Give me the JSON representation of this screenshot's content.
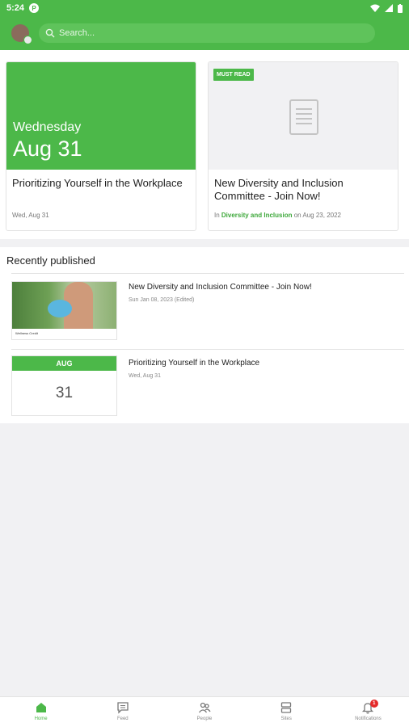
{
  "status_bar": {
    "time": "5:24",
    "app_icon_letter": "P"
  },
  "search": {
    "placeholder": "Search..."
  },
  "featured": [
    {
      "day": "Wednesday",
      "date": "Aug 31",
      "title": "Prioritizing Yourself in the Workplace",
      "meta": "Wed, Aug 31"
    },
    {
      "tag": "MUST READ",
      "title": "New Diversity and Inclusion Committee - Join Now!",
      "meta_prefix": "In",
      "meta_link": "Diversity and Inclusion",
      "meta_suffix": "on Aug 23, 2022"
    }
  ],
  "recent": {
    "heading": "Recently published",
    "items": [
      {
        "title": "New Diversity and Inclusion Committee - Join Now!",
        "meta": "Sun Jan 08, 2023 (Edited)",
        "thumb_caption": "Wellness Credit"
      },
      {
        "title": "Prioritizing Yourself in the Workplace",
        "meta": "Wed, Aug 31",
        "month": "AUG",
        "day": "31"
      }
    ]
  },
  "nav": {
    "items": [
      {
        "label": "Home",
        "icon": "home-icon"
      },
      {
        "label": "Feed",
        "icon": "chat-icon"
      },
      {
        "label": "People",
        "icon": "people-icon"
      },
      {
        "label": "Sites",
        "icon": "sites-icon"
      },
      {
        "label": "Notifications",
        "icon": "bell-icon",
        "badge": "1"
      }
    ]
  },
  "colors": {
    "brand_green": "#4cb849",
    "badge_red": "#e42a2a"
  }
}
